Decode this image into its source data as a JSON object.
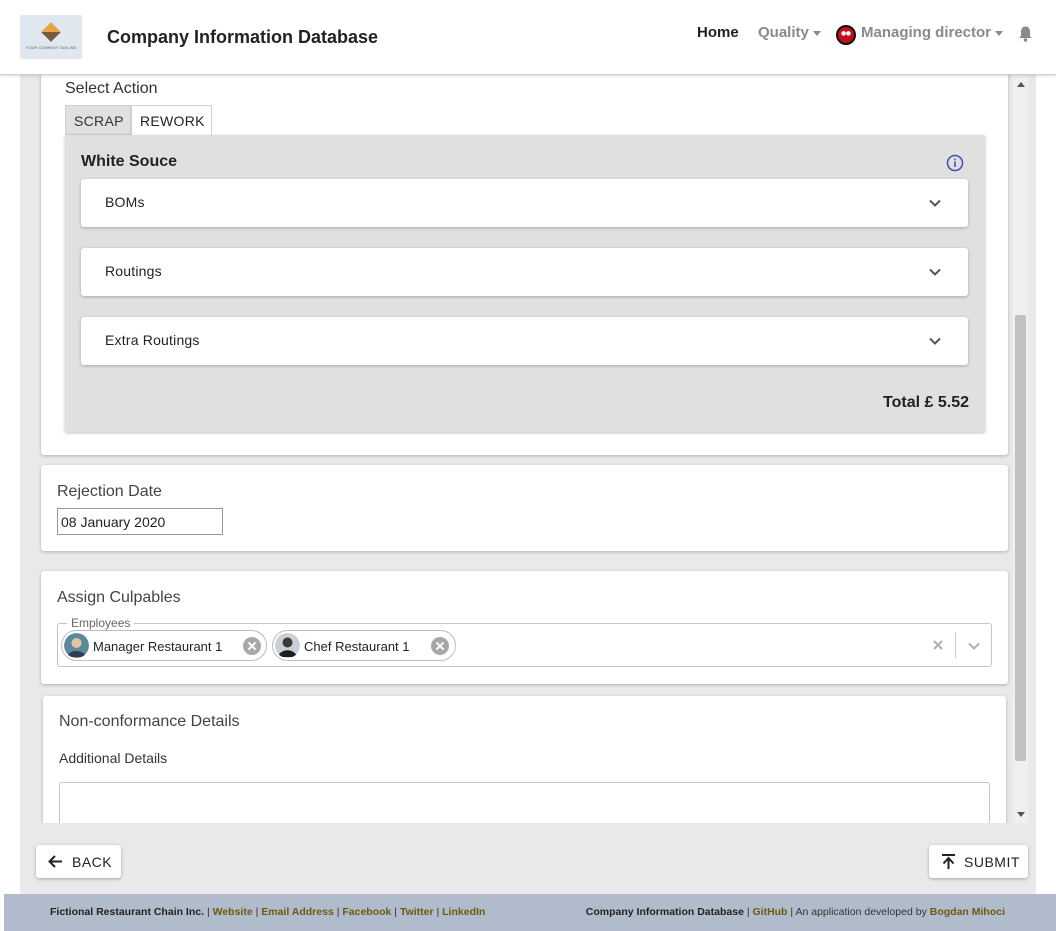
{
  "header": {
    "app_title": "Company Information Database",
    "logo_text": "YOUR COMPANY TAGLINE",
    "nav_home": "Home",
    "nav_quality": "Quality",
    "nav_user": "Managing director"
  },
  "action": {
    "label": "Select Action",
    "tabs": [
      "SCRAP",
      "REWORK"
    ],
    "recipe_title": "White Souce",
    "accordions": [
      "BOMs",
      "Routings",
      "Extra Routings"
    ],
    "total": "Total £ 5.52"
  },
  "rejection": {
    "label": "Rejection Date",
    "date_value": "08 January 2020"
  },
  "culpables": {
    "label": "Assign Culpables",
    "field_label": "Employees",
    "chips": [
      "Manager Restaurant 1",
      "Chef Restaurant 1"
    ]
  },
  "nonconformance": {
    "title": "Non-conformance Details",
    "sub_label": "Additional Details"
  },
  "buttons": {
    "back": "BACK",
    "submit": "SUBMIT"
  },
  "footer": {
    "company": "Fictional Restaurant Chain Inc.",
    "left_links": [
      "Website",
      "Email Address",
      "Facebook",
      "Twitter",
      "LinkedIn"
    ],
    "app_name": "Company Information Database",
    "github": "GitHub",
    "developed_by": "An application developed by",
    "author": "Bogdan Mihoci"
  }
}
